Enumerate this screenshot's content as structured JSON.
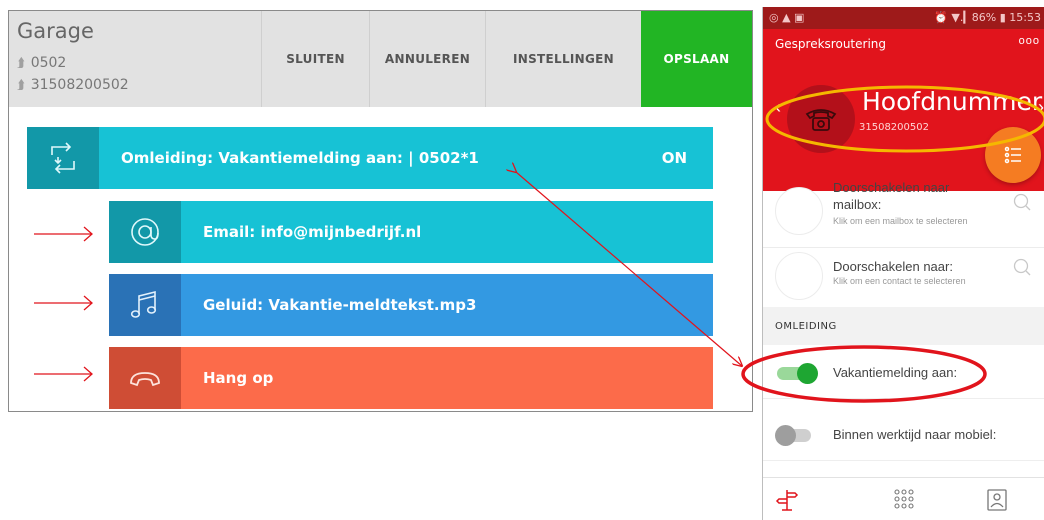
{
  "web": {
    "title": "Garage",
    "numbers": [
      "0502",
      "31508200502"
    ],
    "buttons": {
      "close": "SLUITEN",
      "cancel": "ANNULEREN",
      "settings": "INSTELLINGEN",
      "save": "OPSLAAN"
    },
    "rows": [
      {
        "label": "Omleiding: Vakantiemelding aan: | 0502*1",
        "state": "ON",
        "icon": "transfer-icon",
        "color": "#17c2d5"
      },
      {
        "label": "Email: info@mijnbedrijf.nl",
        "icon": "at-icon",
        "color": "#17c2d5"
      },
      {
        "label": "Geluid: Vakantie-meldtekst.mp3",
        "icon": "music-note-icon",
        "color": "#3399e2"
      },
      {
        "label": "Hang op",
        "icon": "hangup-icon",
        "color": "#fc6b4a"
      }
    ]
  },
  "phone": {
    "status_left": "◎ ▲ ▣",
    "status_right": "⏰ ▼.▎86% ▮ 15:53",
    "app_title": "Gespreksroutering",
    "menu": "ooo",
    "header_title": "Hoofdnummer",
    "header_number": "31508200502",
    "list": [
      {
        "title": "Doorschakelen naar mailbox:",
        "subtitle": "Klik om een mailbox te selecteren"
      },
      {
        "title": "Doorschakelen naar:",
        "subtitle": "Klik om een contact te selecteren"
      }
    ],
    "section": "OMLEIDING",
    "toggles": [
      {
        "label": "Vakantiemelding aan:",
        "on": true
      },
      {
        "label": "Binnen werktijd naar mobiel:",
        "on": false
      }
    ],
    "colors": {
      "header": "#e1141c",
      "fab": "#f57c22",
      "toggle_on": "#1ea632"
    }
  },
  "annotations": {
    "highlight_color": "#f5b800",
    "circle_color": "#e1141c",
    "arrow_color": "#e1141c"
  }
}
